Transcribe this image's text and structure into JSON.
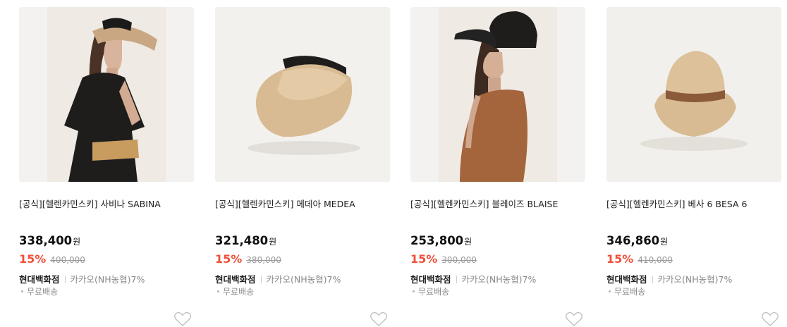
{
  "products": [
    {
      "title": "[공식][헬렌카민스키] 사비나 SABINA",
      "price": "338,400",
      "currency": "원",
      "discount": "15%",
      "original_price": "400,000",
      "seller": "현대백화점",
      "payment": "카카오(NH농협)7%",
      "shipping": "무료배송",
      "icon": "heart-icon"
    },
    {
      "title": "[공식][헬렌카민스키] 메데아 MEDEA",
      "price": "321,480",
      "currency": "원",
      "discount": "15%",
      "original_price": "380,000",
      "seller": "현대백화점",
      "payment": "카카오(NH농협)7%",
      "shipping": "무료배송",
      "icon": "heart-icon"
    },
    {
      "title": "[공식][헬렌카민스키] 블레이즈 BLAISE",
      "price": "253,800",
      "currency": "원",
      "discount": "15%",
      "original_price": "300,000",
      "seller": "현대백화점",
      "payment": "카카오(NH농협)7%",
      "shipping": "무료배송",
      "icon": "heart-icon"
    },
    {
      "title": "[공식][헬렌카민스키] 베사 6 BESA 6",
      "price": "346,860",
      "currency": "원",
      "discount": "15%",
      "original_price": "410,000",
      "seller": "현대백화점",
      "payment": "카카오(NH농협)7%",
      "shipping": "무료배송",
      "icon": "heart-icon"
    }
  ],
  "colors": {
    "discount": "#f04f3a",
    "original_price": "#9a9a9a",
    "muted": "#8a8a8a",
    "thumb_bg": "#f2f1ef"
  }
}
